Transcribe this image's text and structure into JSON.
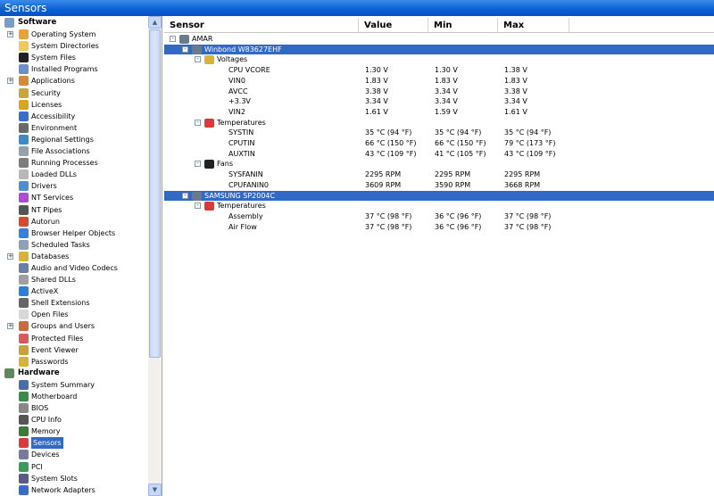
{
  "window": {
    "title": "Sensors"
  },
  "tree": {
    "groups": [
      {
        "label": "Software",
        "icon": "software-icon",
        "items": [
          {
            "label": "Operating System",
            "icon": "windows-flag-icon",
            "expandable": true
          },
          {
            "label": "System Directories",
            "icon": "folder-icon"
          },
          {
            "label": "System Files",
            "icon": "console-icon"
          },
          {
            "label": "Installed Programs",
            "icon": "programs-icon"
          },
          {
            "label": "Applications",
            "icon": "applications-icon",
            "expandable": true
          },
          {
            "label": "Security",
            "icon": "security-shield-icon"
          },
          {
            "label": "Licenses",
            "icon": "lock-icon"
          },
          {
            "label": "Accessibility",
            "icon": "accessibility-icon"
          },
          {
            "label": "Environment",
            "icon": "environment-icon"
          },
          {
            "label": "Regional Settings",
            "icon": "globe-icon"
          },
          {
            "label": "File Associations",
            "icon": "file-association-icon"
          },
          {
            "label": "Running Processes",
            "icon": "processes-icon"
          },
          {
            "label": "Loaded DLLs",
            "icon": "dll-icon"
          },
          {
            "label": "Drivers",
            "icon": "drivers-icon"
          },
          {
            "label": "NT Services",
            "icon": "services-icon"
          },
          {
            "label": "NT Pipes",
            "icon": "pipes-icon"
          },
          {
            "label": "Autorun",
            "icon": "autorun-icon"
          },
          {
            "label": "Browser Helper Objects",
            "icon": "browser-icon"
          },
          {
            "label": "Scheduled Tasks",
            "icon": "clock-icon"
          },
          {
            "label": "Databases",
            "icon": "database-icon",
            "expandable": true
          },
          {
            "label": "Audio and Video Codecs",
            "icon": "codec-icon"
          },
          {
            "label": "Shared DLLs",
            "icon": "shared-dll-icon"
          },
          {
            "label": "ActiveX",
            "icon": "activex-icon"
          },
          {
            "label": "Shell Extensions",
            "icon": "shell-extension-icon"
          },
          {
            "label": "Open Files",
            "icon": "file-icon"
          },
          {
            "label": "Groups and Users",
            "icon": "users-icon",
            "expandable": true
          },
          {
            "label": "Protected Files",
            "icon": "protected-file-icon"
          },
          {
            "label": "Event Viewer",
            "icon": "event-viewer-icon"
          },
          {
            "label": "Passwords",
            "icon": "key-icon"
          }
        ]
      },
      {
        "label": "Hardware",
        "icon": "hardware-icon",
        "items": [
          {
            "label": "System Summary",
            "icon": "computer-icon"
          },
          {
            "label": "Motherboard",
            "icon": "motherboard-icon"
          },
          {
            "label": "BIOS",
            "icon": "bios-chip-icon"
          },
          {
            "label": "CPU Info",
            "icon": "cpu-icon"
          },
          {
            "label": "Memory",
            "icon": "memory-icon"
          },
          {
            "label": "Sensors",
            "icon": "thermometer-icon",
            "selected": true
          },
          {
            "label": "Devices",
            "icon": "devices-icon"
          },
          {
            "label": "PCI",
            "icon": "pci-card-icon"
          },
          {
            "label": "System Slots",
            "icon": "slots-icon"
          },
          {
            "label": "Network Adapters",
            "icon": "network-icon"
          }
        ]
      }
    ]
  },
  "table": {
    "columns": [
      "Sensor",
      "Value",
      "Min",
      "Max"
    ],
    "rows": [
      {
        "label": "AMAR",
        "level": 0,
        "icon": "computer-icon",
        "expand": "-"
      },
      {
        "label": "Winbond W83627EHF",
        "level": 1,
        "icon": "chip-icon",
        "expand": "-",
        "highlight": true
      },
      {
        "label": "Voltages",
        "level": 2,
        "icon": "voltage-wave-icon",
        "expand": "-"
      },
      {
        "label": "CPU VCORE",
        "level": 3,
        "value": "1.30 V",
        "min": "1.30 V",
        "max": "1.38 V"
      },
      {
        "label": "VIN0",
        "level": 3,
        "value": "1.83 V",
        "min": "1.83 V",
        "max": "1.83 V"
      },
      {
        "label": "AVCC",
        "level": 3,
        "value": "3.38 V",
        "min": "3.34 V",
        "max": "3.38 V"
      },
      {
        "label": "+3.3V",
        "level": 3,
        "value": "3.34 V",
        "min": "3.34 V",
        "max": "3.34 V"
      },
      {
        "label": "VIN2",
        "level": 3,
        "value": "1.61 V",
        "min": "1.59 V",
        "max": "1.61 V"
      },
      {
        "label": "Temperatures",
        "level": 2,
        "icon": "thermometer-icon",
        "expand": "-"
      },
      {
        "label": "SYSTIN",
        "level": 3,
        "value": "35 °C  (94 °F)",
        "min": "35 °C  (94 °F)",
        "max": "35 °C  (94 °F)"
      },
      {
        "label": "CPUTIN",
        "level": 3,
        "value": "66 °C  (150 °F)",
        "min": "66 °C  (150 °F)",
        "max": "79 °C  (173 °F)"
      },
      {
        "label": "AUXTIN",
        "level": 3,
        "value": "43 °C  (109 °F)",
        "min": "41 °C  (105 °F)",
        "max": "43 °C  (109 °F)"
      },
      {
        "label": "Fans",
        "level": 2,
        "icon": "fan-icon",
        "expand": "-"
      },
      {
        "label": "SYSFANIN",
        "level": 3,
        "value": "2295 RPM",
        "min": "2295 RPM",
        "max": "2295 RPM"
      },
      {
        "label": "CPUFANIN0",
        "level": 3,
        "value": "3609 RPM",
        "min": "3590 RPM",
        "max": "3668 RPM"
      },
      {
        "label": "SAMSUNG SP2004C",
        "level": 1,
        "icon": "hard-disk-icon",
        "expand": "-",
        "highlight": true
      },
      {
        "label": "Temperatures",
        "level": 2,
        "icon": "thermometer-icon",
        "expand": "-"
      },
      {
        "label": "Assembly",
        "level": 3,
        "value": "37 °C  (98 °F)",
        "min": "36 °C  (96 °F)",
        "max": "37 °C  (98 °F)"
      },
      {
        "label": "Air Flow",
        "level": 3,
        "value": "37 °C  (98 °F)",
        "min": "36 °C  (96 °F)",
        "max": "37 °C  (98 °F)"
      }
    ]
  },
  "colors": {
    "selection": "#316ac5",
    "titlebar": "#0a5fd6"
  }
}
